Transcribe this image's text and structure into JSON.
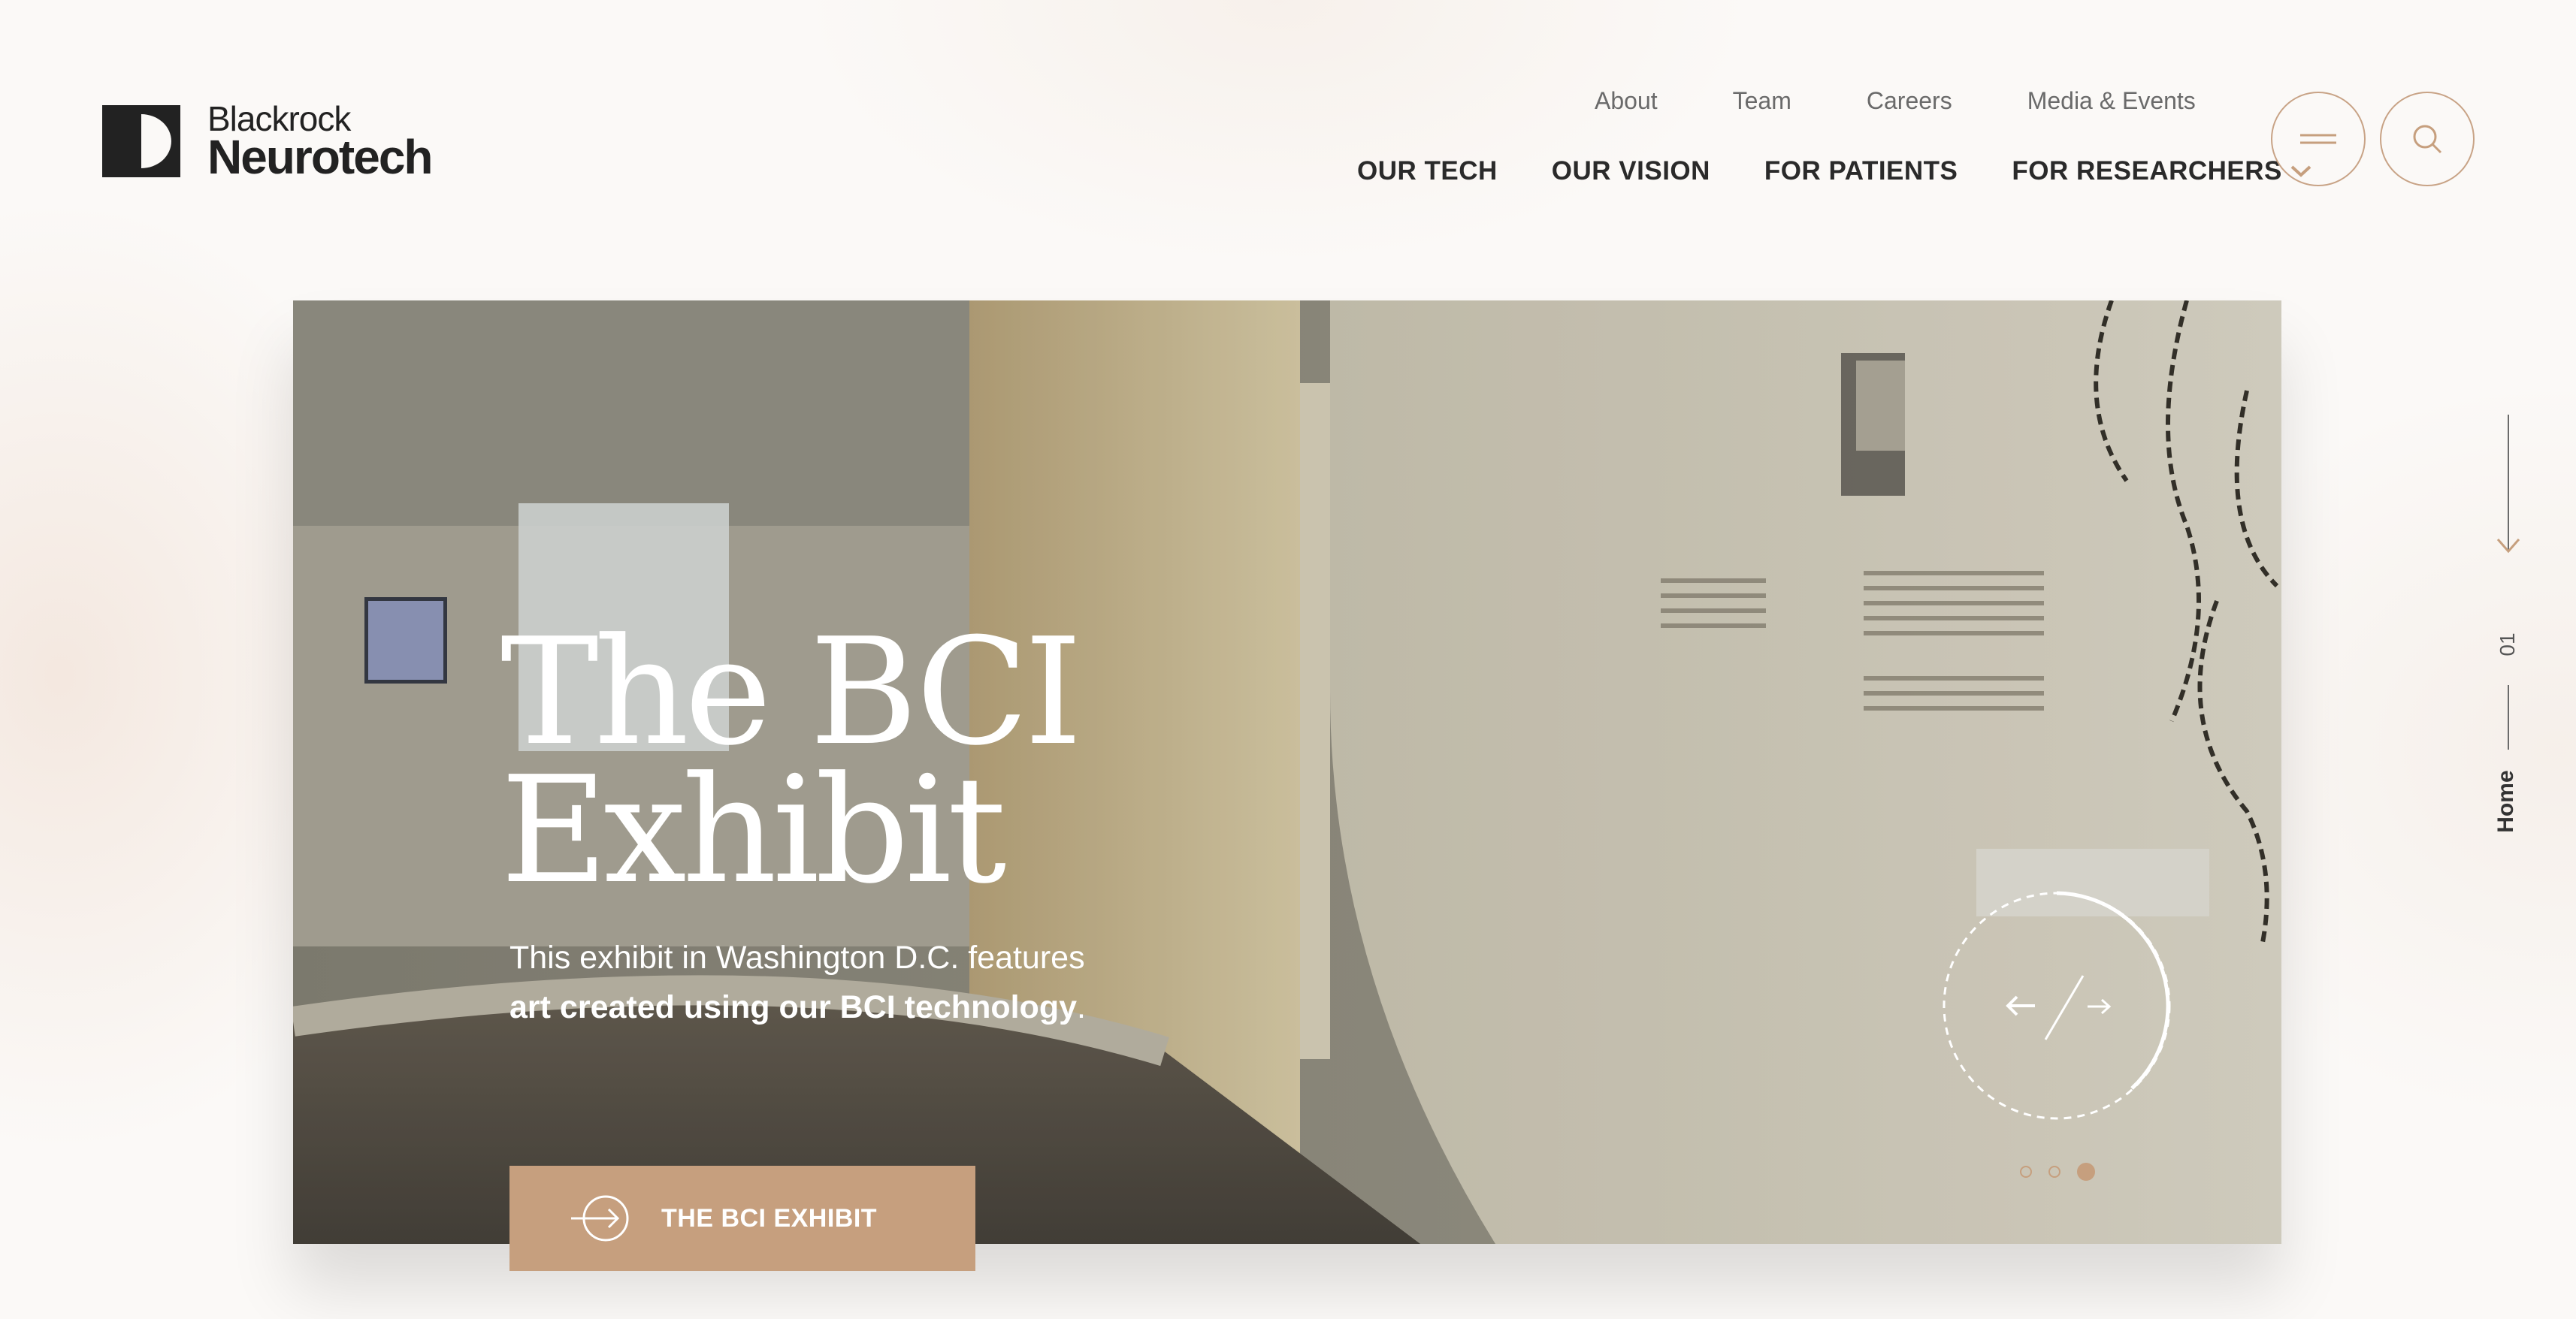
{
  "brand": {
    "name_line1": "Blackrock",
    "name_line2": "Neurotech"
  },
  "nav": {
    "secondary": [
      "About",
      "Team",
      "Careers",
      "Media & Events"
    ],
    "primary": [
      "OUR TECH",
      "OUR VISION",
      "FOR PATIENTS",
      "FOR RESEARCHERS"
    ],
    "dropdown_icon": "chevron-down-icon",
    "menu_icon": "hamburger-icon",
    "search_icon": "search-icon"
  },
  "hero": {
    "title_line1": "The BCI",
    "title_line2": "Exhibit",
    "subtitle_line1": "This exhibit in Washington D.C. features",
    "subtitle_line2_bold": "art created using our BCI technology",
    "subtitle_line2_end": ".",
    "cta_label": "THE BCI EXHIBIT",
    "cta_icon": "arrow-right-circle-icon",
    "prev_icon": "arrow-left-icon",
    "next_icon": "arrow-right-icon",
    "slides_count": 3,
    "active_slide": 3
  },
  "rail": {
    "scroll_icon": "arrow-down-icon",
    "section_number": "01",
    "section_label": "Home"
  },
  "colors": {
    "accent": "#c69f7e",
    "text_dark": "#222222",
    "text_muted": "#6a6a6a",
    "background": "#fbf9f7"
  }
}
